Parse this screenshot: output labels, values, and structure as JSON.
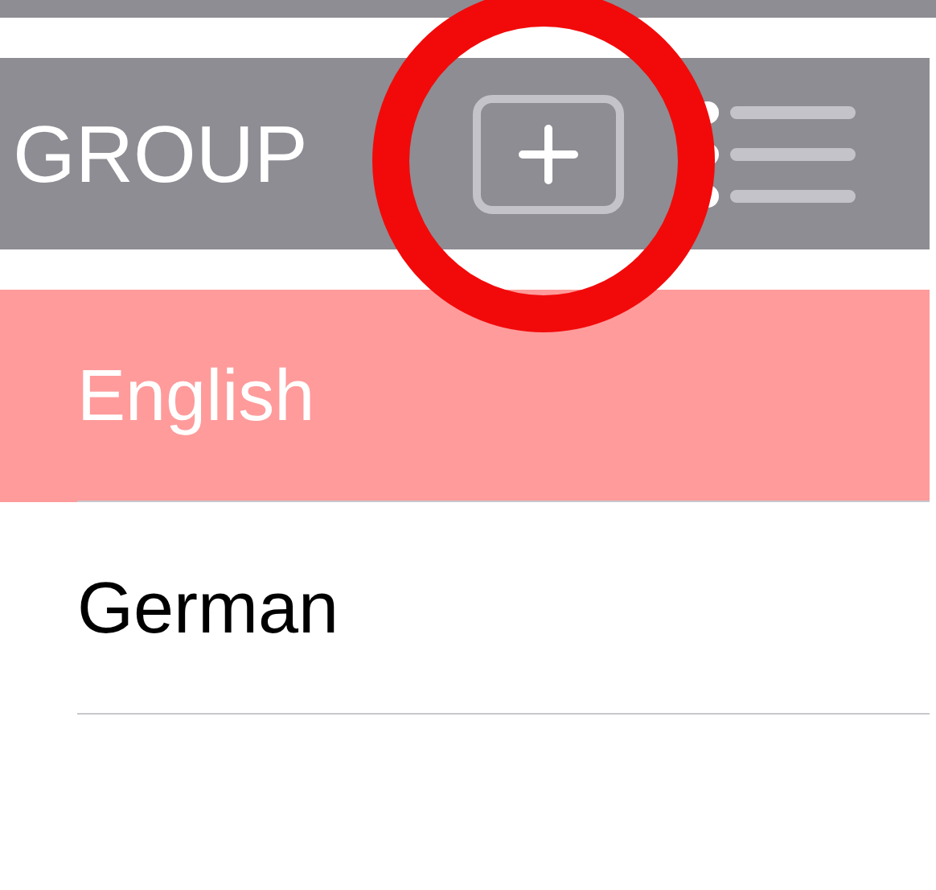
{
  "header": {
    "title": "GROUP"
  },
  "items": [
    {
      "label": "English",
      "selected": true
    },
    {
      "label": "German",
      "selected": false
    }
  ],
  "annotation": {
    "color": "#f20a0a"
  }
}
